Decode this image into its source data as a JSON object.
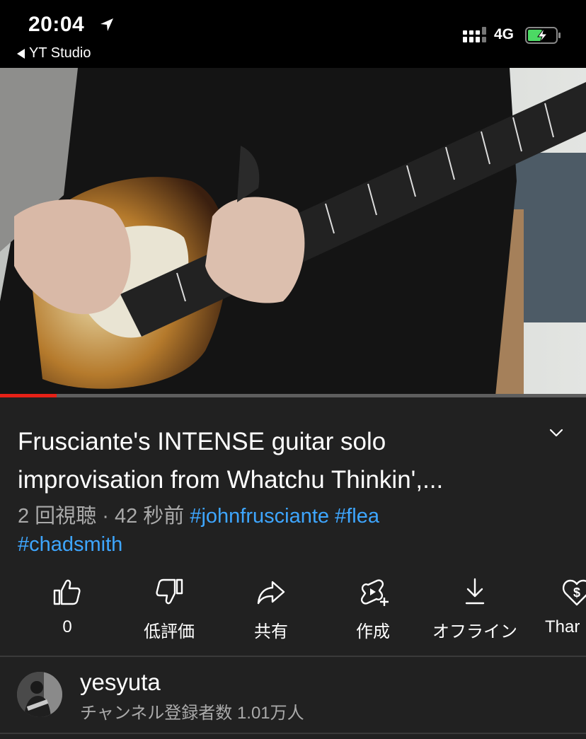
{
  "status_bar": {
    "time": "20:04",
    "back_app": "YT Studio",
    "network": "4G",
    "icons": [
      "location-arrow-icon",
      "signal-bars-icon",
      "battery-charging-icon"
    ]
  },
  "player": {
    "progress_fraction": 0.097,
    "progress_color": "#e62117"
  },
  "video": {
    "title_line1": "Frusciante's INTENSE guitar solo",
    "title_line2": "improvisation from Whatchu Thinkin',...",
    "views_time": "2 回視聴 · 42 秒前",
    "hashtags": [
      "#johnfrusciante",
      "#flea",
      "#chadsmith"
    ]
  },
  "actions": {
    "like": {
      "icon": "thumbs-up-icon",
      "label": "0"
    },
    "dislike": {
      "icon": "thumbs-down-icon",
      "label": "低評価"
    },
    "share": {
      "icon": "share-arrow-icon",
      "label": "共有"
    },
    "create": {
      "icon": "create-shorts-icon",
      "label": "作成"
    },
    "offline": {
      "icon": "download-icon",
      "label": "オフライン"
    },
    "thanks": {
      "icon": "super-thanks-icon",
      "label": "Thar"
    }
  },
  "channel": {
    "name": "yesyuta",
    "subscribers": "チャンネル登録者数 1.01万人"
  },
  "colors": {
    "background": "#212121",
    "hashtag": "#3ea6ff",
    "secondary_text": "#aaaaaa"
  }
}
